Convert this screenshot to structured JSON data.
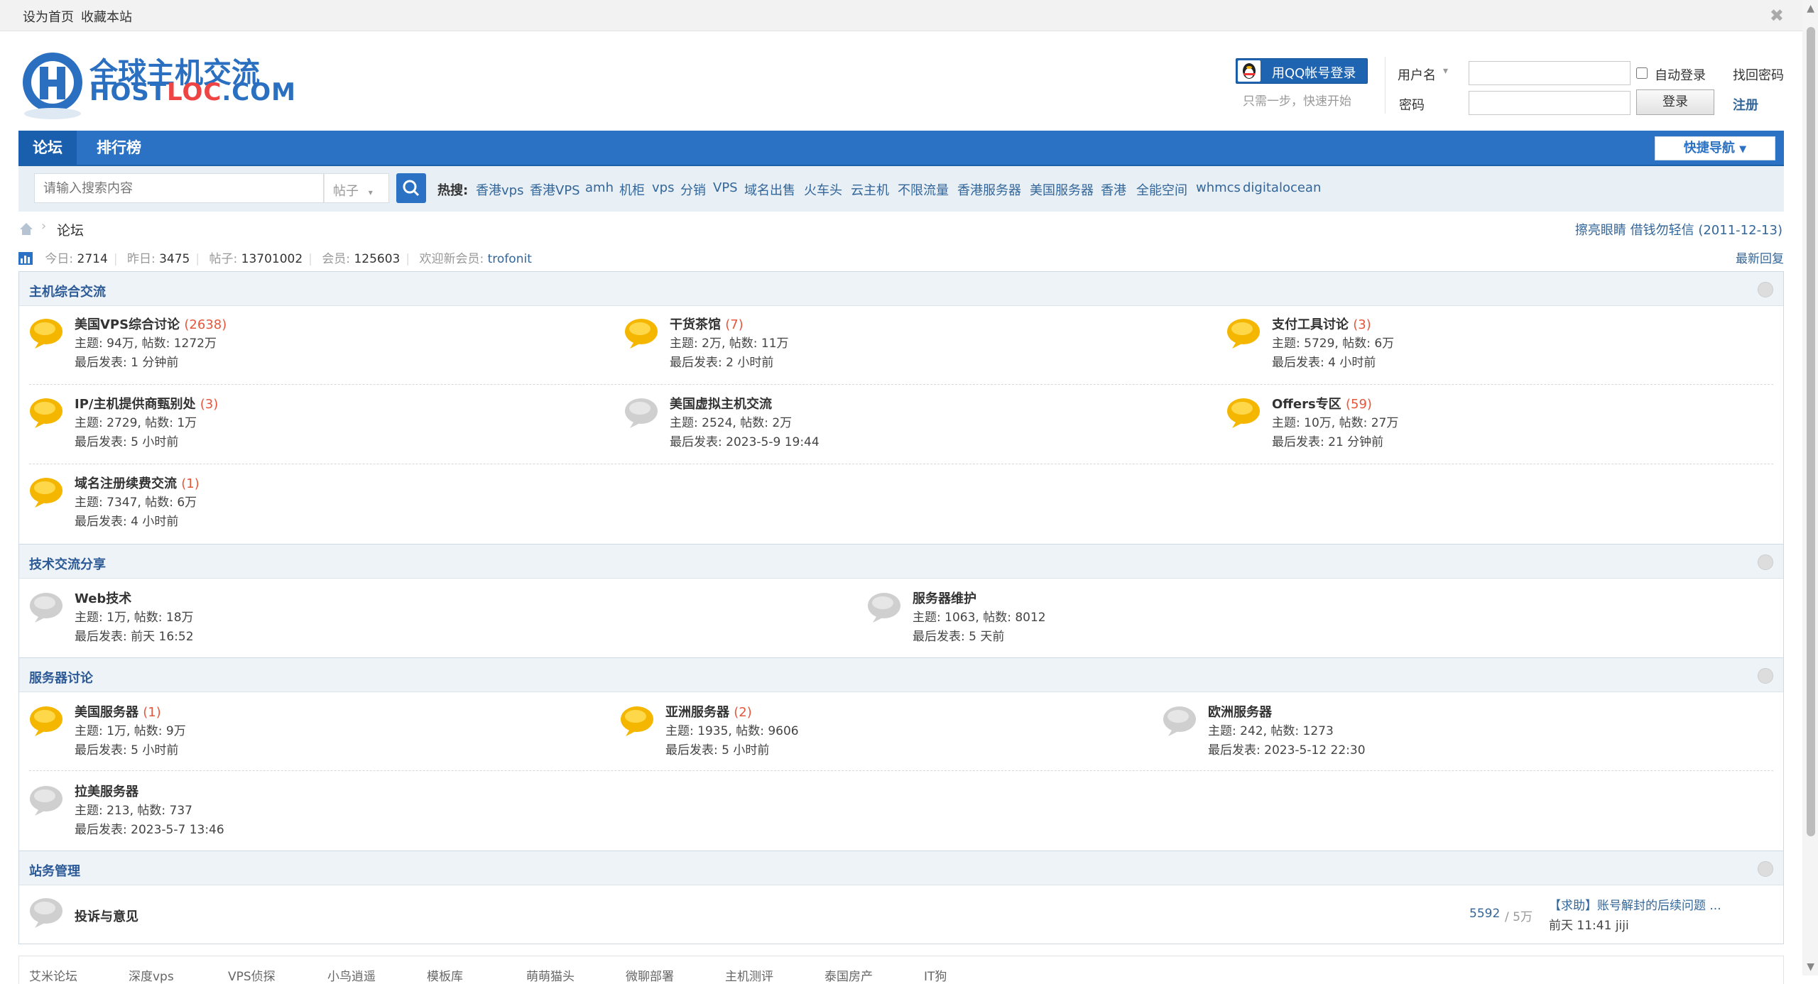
{
  "topbar": {
    "set_home": "设为首页",
    "bookmark": "收藏本站"
  },
  "logo": {
    "cn": "全球主机交流",
    "en_a": "HOST",
    "en_b": "LOC",
    "en_c": ".COM"
  },
  "header": {
    "qq_login": "用QQ帐号登录",
    "qq_hint": "只需一步，快速开始",
    "username_label": "用户名",
    "password_label": "密码",
    "auto_login": "自动登录",
    "login_btn": "登录",
    "find_pwd": "找回密码",
    "register": "注册"
  },
  "nav": {
    "tabs": [
      "论坛",
      "排行榜"
    ],
    "quick_nav": "快捷导航"
  },
  "search": {
    "placeholder": "请输入搜索内容",
    "type": "帖子",
    "hot_label": "热搜:",
    "hot": [
      "香港vps",
      "香港VPS",
      "amh",
      "机柜",
      "vps",
      "分销",
      "VPS",
      "域名出售",
      "火车头",
      "云主机",
      "不限流量",
      "香港服务器",
      "美国服务器",
      "香港",
      "全能空间",
      "whmcs",
      "digitalocean"
    ]
  },
  "breadcrumb": {
    "current": "论坛"
  },
  "notice": "擦亮眼睛 借钱勿轻信 (2011-12-13)",
  "stats": {
    "today_label": "今日:",
    "today": "2714",
    "yesterday_label": "昨日:",
    "yesterday": "3475",
    "posts_label": "帖子:",
    "posts": "13701002",
    "members_label": "会员:",
    "members": "125603",
    "welcome_label": "欢迎新会员:",
    "new_member": "trofonit"
  },
  "latest_reply": "最新回复",
  "sections": [
    {
      "title": "主机综合交流",
      "forums": [
        {
          "name": "美国VPS综合讨论",
          "new": "(2638)",
          "stats": "主题: 94万, 帖数: 1272万",
          "last": "最后发表: 1 分钟前",
          "active": true
        },
        {
          "name": "干货茶馆",
          "new": "(7)",
          "stats": "主题: 2万, 帖数: 11万",
          "last": "最后发表: 2 小时前",
          "active": true
        },
        {
          "name": "支付工具讨论",
          "new": "(3)",
          "stats": "主题: 5729, 帖数: 6万",
          "last": "最后发表: 4 小时前",
          "active": true
        },
        {
          "name": "IP/主机提供商甄别处",
          "new": "(3)",
          "stats": "主题: 2729, 帖数: 1万",
          "last": "最后发表: 5 小时前",
          "active": true
        },
        {
          "name": "美国虚拟主机交流",
          "new": "",
          "stats": "主题: 2524, 帖数: 2万",
          "last": "最后发表: 2023-5-9 19:44",
          "active": false
        },
        {
          "name": "Offers专区",
          "new": "(59)",
          "stats": "主题: 10万, 帖数: 27万",
          "last": "最后发表: 21 分钟前",
          "active": true
        },
        {
          "name": "域名注册续费交流",
          "new": "(1)",
          "stats": "主题: 7347, 帖数: 6万",
          "last": "最后发表: 4 小时前",
          "active": true
        }
      ]
    },
    {
      "title": "技术交流分享",
      "forums": [
        {
          "name": "Web技术",
          "new": "",
          "stats": "主题: 1万, 帖数: 18万",
          "last": "最后发表: 前天 16:52",
          "active": false
        },
        {
          "name": "服务器维护",
          "new": "",
          "stats": "主题: 1063, 帖数: 8012",
          "last": "最后发表: 5 天前",
          "active": false
        }
      ]
    },
    {
      "title": "服务器讨论",
      "forums": [
        {
          "name": "美国服务器",
          "new": "(1)",
          "stats": "主题: 1万, 帖数: 9万",
          "last": "最后发表: 5 小时前",
          "active": true
        },
        {
          "name": "亚洲服务器",
          "new": "(2)",
          "stats": "主题: 1935, 帖数: 9606",
          "last": "最后发表: 5 小时前",
          "active": true
        },
        {
          "name": "欧洲服务器",
          "new": "",
          "stats": "主题: 242, 帖数: 1273",
          "last": "最后发表: 2023-5-12 22:30",
          "active": false
        },
        {
          "name": "拉美服务器",
          "new": "",
          "stats": "主题: 213, 帖数: 737",
          "last": "最后发表: 2023-5-7 13:46",
          "active": false
        }
      ]
    },
    {
      "title": "站务管理",
      "forums": [
        {
          "name": "投诉与意见",
          "new": "",
          "active": false,
          "count": "5592",
          "total": "/ 5万",
          "last_title": "【求助】账号解封的后续问题 ...",
          "last_time": "前天 11:41",
          "last_user": "jiji"
        }
      ]
    }
  ],
  "bottom_links": [
    "艾米论坛",
    "深度vps",
    "VPS侦探",
    "小鸟逍遥",
    "模板库",
    "萌萌猫头",
    "微聊部署",
    "主机测评",
    "泰国房产",
    "IT狗"
  ],
  "colors": {
    "nav": "#2b72c4",
    "link": "#336699",
    "new_count": "#e4573c",
    "section_title": "#2c5a96"
  }
}
